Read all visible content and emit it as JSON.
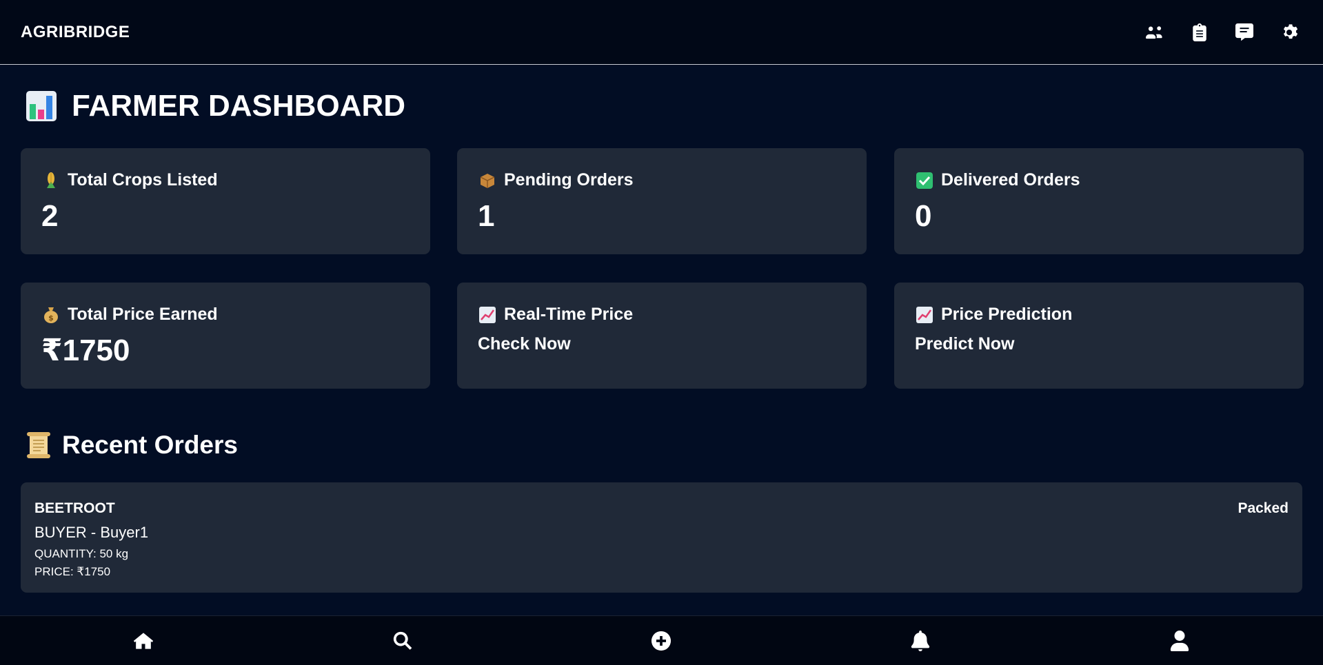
{
  "header": {
    "brand": "AGRIBRIDGE",
    "icons": [
      "users-icon",
      "clipboard-icon",
      "chat-icon",
      "gear-icon"
    ]
  },
  "page": {
    "title": "FARMER DASHBOARD",
    "title_icon": "bar-chart-icon"
  },
  "stats": {
    "crops": {
      "label": "Total Crops Listed",
      "value": "2",
      "icon": "corn-icon"
    },
    "pending": {
      "label": "Pending Orders",
      "value": "1",
      "icon": "package-icon"
    },
    "delivered": {
      "label": "Delivered Orders",
      "value": "0",
      "icon": "check-icon"
    },
    "earned": {
      "label": "Total Price Earned",
      "value": "₹1750",
      "icon": "money-bag-icon"
    },
    "realtime": {
      "label": "Real-Time Price",
      "action": "Check Now",
      "icon": "trend-chart-icon"
    },
    "prediction": {
      "label": "Price Prediction",
      "action": "Predict Now",
      "icon": "trend-chart-icon"
    }
  },
  "recent": {
    "title": "Recent Orders",
    "icon": "scroll-icon",
    "orders": [
      {
        "crop": "BEETROOT",
        "buyer": "BUYER - Buyer1",
        "quantity": "QUANTITY: 50 kg",
        "price": "PRICE: ₹1750",
        "status": "Packed"
      }
    ]
  },
  "bottom_nav": [
    "home-icon",
    "search-icon",
    "add-icon",
    "bell-icon",
    "user-icon"
  ],
  "colors": {
    "background": "#020d24",
    "card": "#202938",
    "text": "#ffffff"
  }
}
